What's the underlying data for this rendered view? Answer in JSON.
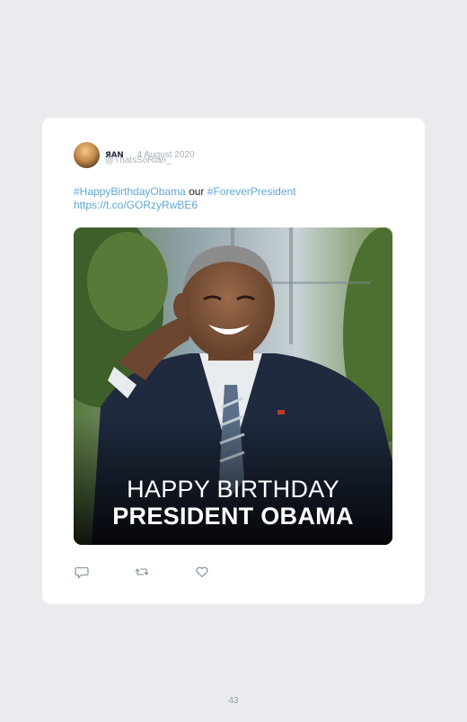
{
  "tweet": {
    "author_name": "ЯAN",
    "separator": "·",
    "date": "4 August 2020",
    "handle": "@ThatsSoRian_",
    "hashtag_1": "#HappyBirthdayObama",
    "word": "our",
    "hashtag_2": "#ForeverPresident",
    "url": "https://t.co/GORzyRwBE6",
    "image_caption_line1": "HAPPY BIRTHDAY",
    "image_caption_line2": "PRESIDENT OBAMA"
  },
  "actions": {
    "reply_icon": "reply-icon",
    "retweet_icon": "retweet-icon",
    "like_icon": "heart-icon"
  },
  "footer": {
    "page_number": "43"
  },
  "colors": {
    "background": "#e9ebee",
    "card": "#ffffff",
    "link": "#5fa8d3",
    "muted": "#a6b0ba"
  }
}
